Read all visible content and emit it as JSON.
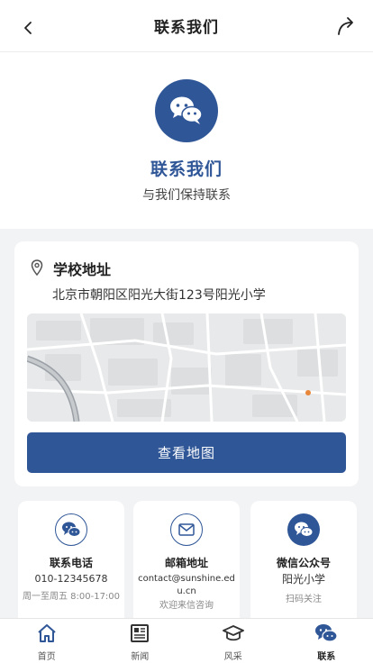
{
  "header": {
    "title": "联系我们"
  },
  "hero": {
    "title": "联系我们",
    "subtitle": "与我们保持联系"
  },
  "address": {
    "title": "学校地址",
    "text": "北京市朝阳区阳光大街123号阳光小学",
    "map_button": "查看地图"
  },
  "contacts": [
    {
      "title": "联系电话",
      "value": "010-12345678",
      "note": "周一至周五 8:00-17:00",
      "icon": "chat-icon"
    },
    {
      "title": "邮箱地址",
      "value": "contact@sunshine.edu.cn",
      "note": "欢迎来信咨询",
      "icon": "mail-icon"
    },
    {
      "title": "微信公众号",
      "value": "阳光小学",
      "note": "扫码关注",
      "icon": "wechat-icon"
    }
  ],
  "tabs": [
    {
      "label": "首页",
      "icon": "home-icon"
    },
    {
      "label": "新闻",
      "icon": "news-icon"
    },
    {
      "label": "风采",
      "icon": "graduation-cap-icon"
    },
    {
      "label": "联系",
      "icon": "wechat-icon",
      "active": true
    }
  ],
  "colors": {
    "primary": "#2f5697",
    "background": "#f2f3f5",
    "card": "#ffffff"
  }
}
